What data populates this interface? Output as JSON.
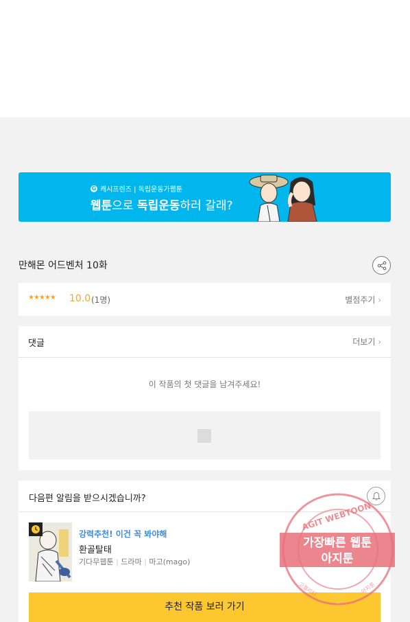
{
  "banner": {
    "brand": "캐시프렌즈 | 독립운동가웹툰",
    "headline_pre": "웹툰",
    "headline_mid1": "으로 ",
    "headline_bold": "독립운동",
    "headline_post": "하러 갈래?",
    "colors": {
      "background": "#00b6ec",
      "text": "#ffffff"
    }
  },
  "episode": {
    "title": "만해몬 어드벤처 10화",
    "share_icon": "share-icon"
  },
  "rating": {
    "stars": "★★★★★",
    "score": "10.0",
    "count": "(1명)",
    "rate_label": "별점주기",
    "color": "#f5a623"
  },
  "comments": {
    "title": "댓글",
    "more_label": "더보기",
    "empty_message": "이 작품의 첫 댓글을 남겨주세요!"
  },
  "notification": {
    "prompt": "다음편 알림을 받으시겠습니까?",
    "bell_icon": "bell-icon",
    "recommendation": {
      "badge": "강력추천! 이건 꼭 봐야해",
      "title": "환골탈태",
      "platform": "기다무웹툰",
      "genre": "드라마",
      "author": "마고(mago)"
    },
    "cta_label": "추천 작품 보러 가기",
    "cta_color": "#fdc82f"
  },
  "watermark": {
    "arc_text": "AGIT WEBTOON",
    "line1": "가장빠른 웹툰",
    "line2": "아지툰",
    "left_small": "고퀄리티",
    "right_small": "아지툰"
  }
}
